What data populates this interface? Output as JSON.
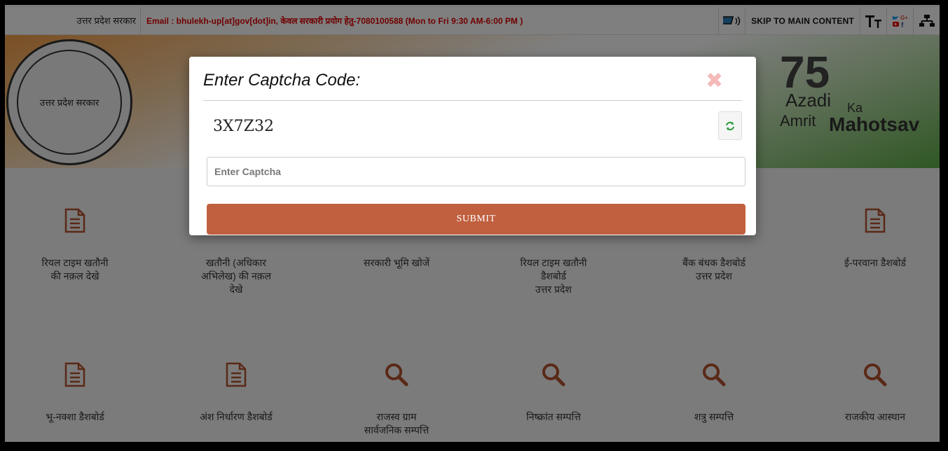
{
  "topbar": {
    "govt_label": "उत्तर प्रदेश सरकार",
    "email_text": "Email : bhulekh-up[at]gov[dot]in, केवल सरकारी प्रयोग हेतु-7080100588 (Mon to Fri 9:30 AM-6:00 PM )",
    "skip_label": "SKIP TO MAIN CONTENT",
    "icons": [
      "screen-reader-icon",
      "text-size-icon",
      "social-media-icon",
      "sitemap-icon"
    ]
  },
  "banner": {
    "emblem_text": "उत्तर प्रदेश सरकार",
    "azadi": {
      "line1": "Azadi",
      "ka": "Ka",
      "line2": "Amrit",
      "line3": "Mahotsav"
    }
  },
  "cards": [
    {
      "label": "रियल टाइम खतौनी\nकी नक़ल देखे",
      "icon": "document-icon"
    },
    {
      "label": "खतौनी (अधिकार\nअभिलेख) की नक़ल\nदेखे",
      "icon": "document-icon"
    },
    {
      "label": "सरकारी भूमि खोजें",
      "icon": "search-icon"
    },
    {
      "label": "रियल टाइम खतौनी\nडैशबोर्ड\nउत्तर प्रदेश",
      "icon": "document-icon"
    },
    {
      "label": "बैंक बंधक डैशबोर्ड\nउत्तर प्रदेश",
      "icon": "document-icon"
    },
    {
      "label": "ई-परवाना डैशबोर्ड",
      "icon": "document-icon"
    },
    {
      "label": "भू-नक्शा डैशबोर्ड",
      "icon": "document-icon"
    },
    {
      "label": "अंश निर्धारण डैशबोर्ड",
      "icon": "document-icon"
    },
    {
      "label": "राजस्व ग्राम\nसार्वजनिक सम्पत्ति",
      "icon": "search-icon"
    },
    {
      "label": "निष्क्रांत सम्पत्ति",
      "icon": "search-icon"
    },
    {
      "label": "शत्रु सम्पत्ति",
      "icon": "search-icon"
    },
    {
      "label": "राजकीय आस्थान",
      "icon": "search-icon"
    }
  ],
  "modal": {
    "title": "Enter Captcha Code:",
    "close_icon": "close-icon",
    "captcha_value": "3X7Z32",
    "refresh_icon": "refresh-icon",
    "input_placeholder": "Enter Captcha",
    "input_value": "",
    "submit_label": "SUBMIT"
  },
  "colors": {
    "accent": "#c0603f",
    "icon_color": "#b5532f",
    "alert_text": "#e00000",
    "close": "#f6b9b9"
  }
}
